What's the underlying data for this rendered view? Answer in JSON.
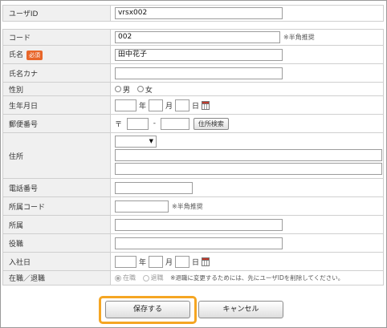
{
  "form": {
    "user_id": {
      "label": "ユーザID",
      "value": "vrsx002"
    },
    "code": {
      "label": "コード",
      "value": "002",
      "note": "※半角推奨"
    },
    "name": {
      "label": "氏名",
      "required_badge": "必須",
      "value": "田中花子"
    },
    "name_kana": {
      "label": "氏名カナ",
      "value": ""
    },
    "gender": {
      "label": "性別",
      "options": [
        "男",
        "女"
      ],
      "selected": ""
    },
    "birthdate": {
      "label": "生年月日",
      "year_unit": "年",
      "month_unit": "月",
      "day_unit": "日",
      "year": "",
      "month": "",
      "day": ""
    },
    "postal": {
      "label": "郵便番号",
      "prefix": "〒",
      "separator": "-",
      "search_button": "住所検索",
      "part1": "",
      "part2": ""
    },
    "address": {
      "label": "住所",
      "pref_select": "",
      "line1": "",
      "line2": ""
    },
    "phone": {
      "label": "電話番号",
      "value": ""
    },
    "dept_code": {
      "label": "所属コード",
      "value": "",
      "note": "※半角推奨"
    },
    "dept": {
      "label": "所属",
      "value": ""
    },
    "position": {
      "label": "役職",
      "value": ""
    },
    "join_date": {
      "label": "入社日",
      "year_unit": "年",
      "month_unit": "月",
      "day_unit": "日"
    },
    "employment": {
      "label": "在職／退職",
      "options": [
        "在職",
        "退職"
      ],
      "selected": "在職",
      "note": "※退職に変更するためには、先にユーザIDを削除してください。"
    }
  },
  "buttons": {
    "save": "保存する",
    "cancel": "キャンセル"
  },
  "colors": {
    "highlight": "#f5a623",
    "required_badge": "#e8662a",
    "label_bg": "#f0f0f0"
  }
}
